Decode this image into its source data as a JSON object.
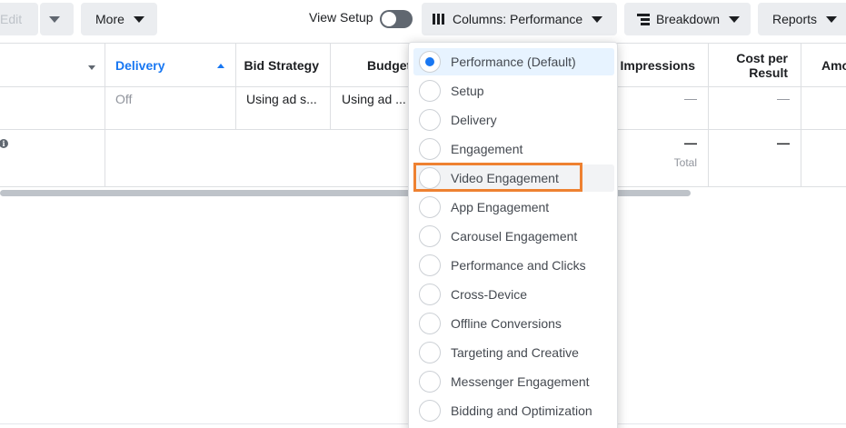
{
  "toolbar": {
    "edit_label": "Edit",
    "more_label": "More",
    "view_setup_label": "View Setup",
    "columns_label": "Columns: Performance",
    "breakdown_label": "Breakdown",
    "reports_label": "Reports"
  },
  "table": {
    "headers": {
      "delivery": "Delivery",
      "bid_strategy": "Bid Strategy",
      "budget": "Budget",
      "impressions": "Impressions",
      "cost_per_result_line1": "Cost per",
      "cost_per_result_line2": "Result",
      "amount": "Amo"
    },
    "row1": {
      "delivery": "Off",
      "bid_strategy": "Using ad s...",
      "budget": "Using ad ...",
      "impressions": "—",
      "cost_per_result": "—"
    },
    "row2": {
      "impressions": "—",
      "impressions_note": "Total",
      "cost_per_result": "—"
    }
  },
  "columns_menu": {
    "selected": "Performance (Default)",
    "options": [
      "Performance (Default)",
      "Setup",
      "Delivery",
      "Engagement",
      "Video Engagement",
      "App Engagement",
      "Carousel Engagement",
      "Performance and Clicks",
      "Cross-Device",
      "Offline Conversions",
      "Targeting and Creative",
      "Messenger Engagement",
      "Bidding and Optimization"
    ]
  },
  "colors": {
    "accent": "#1877f2",
    "highlight_outline": "#ee8131",
    "button_bg": "#ebedf0"
  }
}
